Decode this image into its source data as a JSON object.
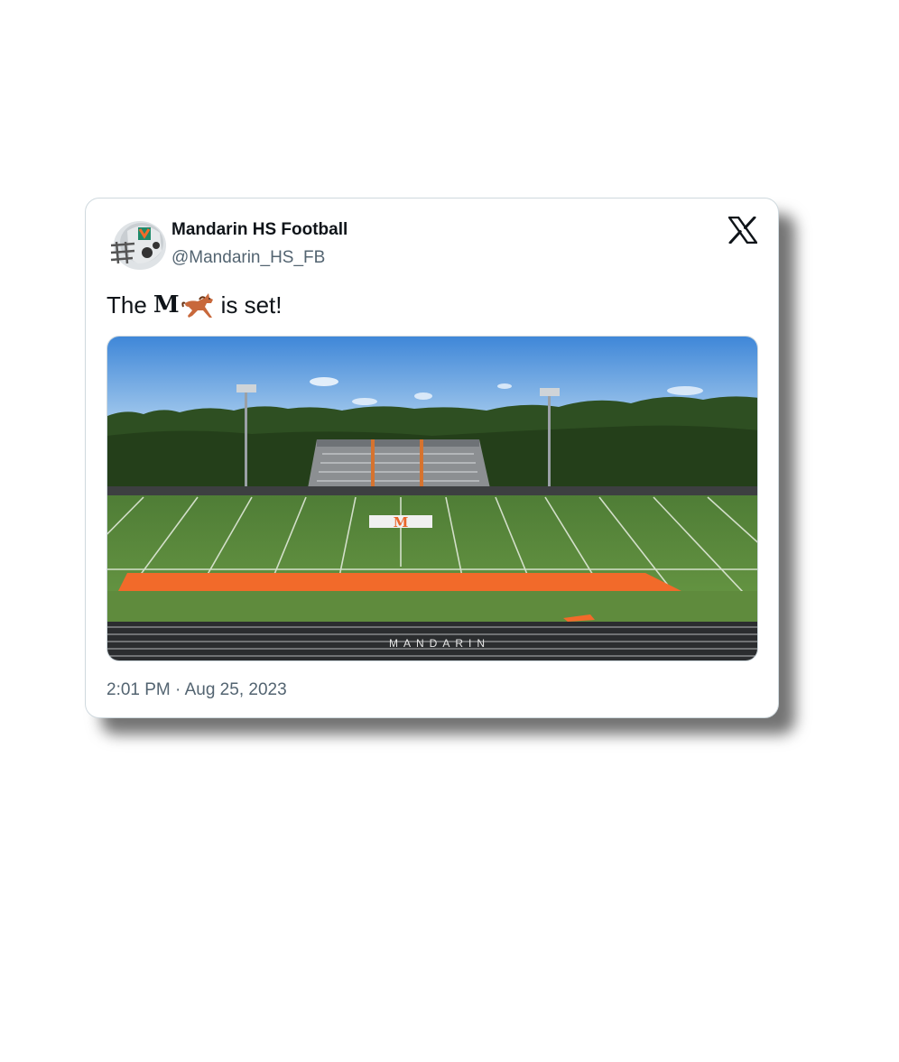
{
  "tweet": {
    "display_name": "Mandarin HS Football",
    "handle": "@Mandarin_HS_FB",
    "text_before": "The",
    "text_bold": "M",
    "text_emoji": "horse-emoji",
    "text_after": "is set!",
    "timestamp": "2:01 PM · Aug 25, 2023",
    "media_banner_text": "MANDARIN",
    "media_field_logo": "M"
  },
  "icons": {
    "brand": "x-logo-icon",
    "avatar": "helmet-avatar-icon"
  },
  "colors": {
    "name": "#0f1419",
    "secondary": "#536471",
    "border": "#cfd9de",
    "accent_orange": "#f26a2a",
    "field_green": "#5e8e3c"
  }
}
